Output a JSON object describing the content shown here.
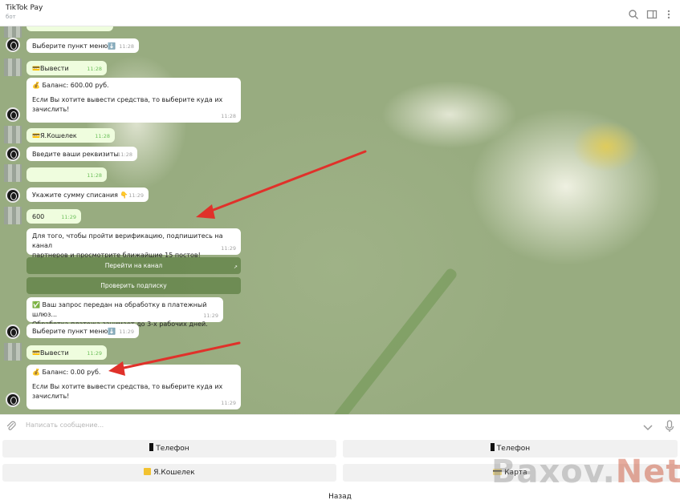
{
  "header": {
    "title": "TikTok Pay",
    "subtitle": "бот"
  },
  "messages": {
    "m1": {
      "text": "Выберите пункт меню⬇️",
      "time": "11:28"
    },
    "m2": {
      "text": "💳Вывести",
      "time": "11:28"
    },
    "m3": {
      "line1": "💰 Баланс: 600.00 руб.",
      "line2": "Если Вы хотите вывести средства, то выберите куда их",
      "line3": "зачислить!",
      "time": "11:28"
    },
    "m4": {
      "text": "💳Я.Кошелек",
      "time": "11:28"
    },
    "m5": {
      "text": "Введите ваши реквизиты",
      "time": "11:28"
    },
    "m6": {
      "time": "11:28"
    },
    "m7": {
      "text": "Укажите сумму списания 👇",
      "time": "11:29"
    },
    "m8": {
      "text": "600",
      "time": "11:29"
    },
    "m9": {
      "line1": "Для того, чтобы пройти верификацию, подпишитесь на канал",
      "line2": "партнеров и просмотрите ближайшие 15 постов!",
      "time": "11:29"
    },
    "btn_channel": "Перейти на канал",
    "btn_check": "Проверить подписку",
    "m10": {
      "line1": "✅ Ваш запрос передан на обработку в платежный шлюз...",
      "line2": "Обработка платежа занимает до 3-х рабочих дней.",
      "time": "11:29"
    },
    "m11": {
      "text": "Выберите пункт меню⬇️",
      "time": "11:29"
    },
    "m12": {
      "text": "💳Вывести",
      "time": "11:29"
    },
    "m13": {
      "line1": "💰 Баланс: 0.00 руб.",
      "line2": "Если Вы хотите вывести средства, то выберите куда их",
      "line3": "зачислить!",
      "time": "11:29"
    }
  },
  "input": {
    "placeholder": "Написать сообщение..."
  },
  "keyboard": {
    "phone_left": "Телефон",
    "phone_right": "Телефон",
    "wallet": "Я.Кошелек",
    "card": "Карта",
    "back": "Назад"
  },
  "watermark": {
    "part1": "Baxov.",
    "part2": "Net"
  },
  "colors": {
    "arrow": "#e0312a",
    "inline_button": "#5f8044",
    "outgoing_bubble": "#effdde"
  },
  "icons": [
    "search-icon",
    "sidebar-icon",
    "more-icon",
    "paperclip-icon",
    "chevron-down-icon",
    "mic-icon",
    "bot-avatar-icon",
    "phone-icon",
    "wallet-icon",
    "card-icon",
    "money-bag-icon",
    "check-icon"
  ]
}
